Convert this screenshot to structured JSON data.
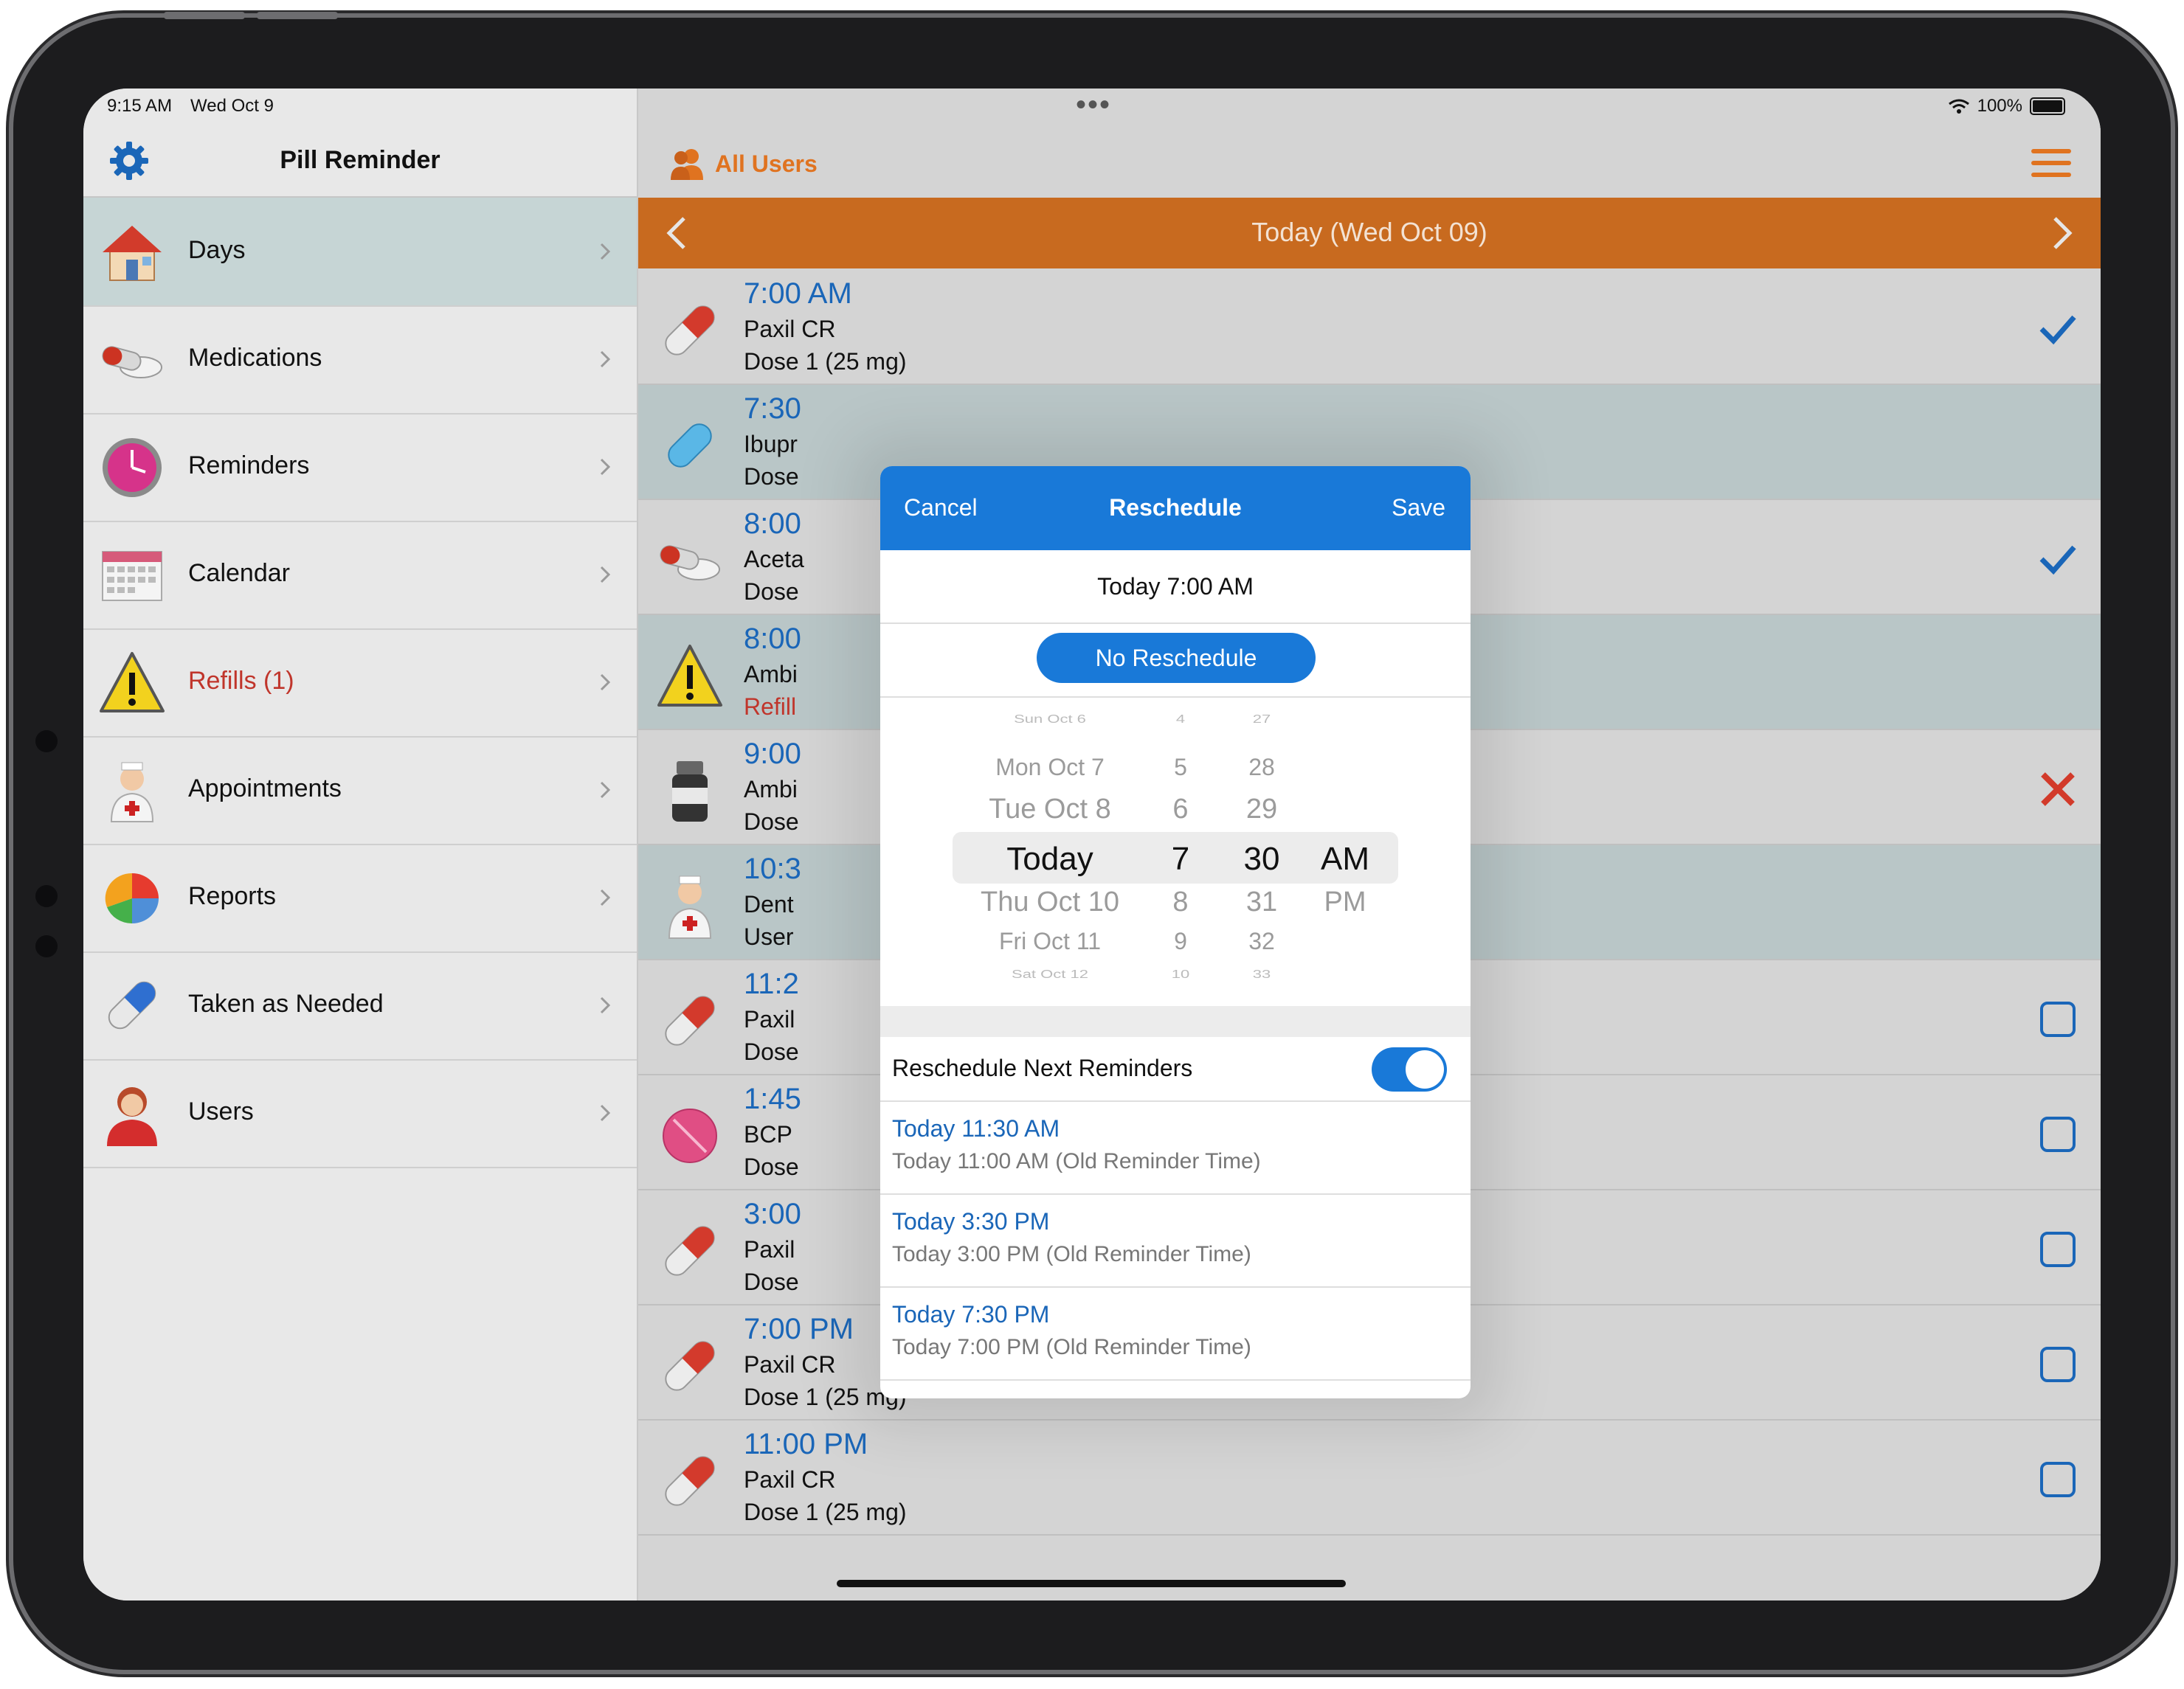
{
  "status": {
    "time": "9:15 AM",
    "date": "Wed Oct 9",
    "dots": "•••",
    "battery": "100%"
  },
  "sidebar": {
    "title": "Pill Reminder",
    "items": [
      {
        "label": "Days"
      },
      {
        "label": "Medications"
      },
      {
        "label": "Reminders"
      },
      {
        "label": "Calendar"
      },
      {
        "label": "Refills (1)"
      },
      {
        "label": "Appointments"
      },
      {
        "label": "Reports"
      },
      {
        "label": "Taken as Needed"
      },
      {
        "label": "Users"
      }
    ]
  },
  "header": {
    "users_label": "All Users",
    "date_title": "Today (Wed Oct 09)"
  },
  "reminders": [
    {
      "time": "7:00 AM",
      "name": "Paxil CR",
      "detail": "Dose 1 (25 mg)",
      "status": "taken"
    },
    {
      "time": "7:30",
      "name": "Ibupr",
      "detail": "Dose",
      "status": "none"
    },
    {
      "time": "8:00",
      "name": "Aceta",
      "detail": "Dose",
      "status": "taken"
    },
    {
      "time": "8:00",
      "name": "Ambi",
      "detail": "Refill",
      "status": "none"
    },
    {
      "time": "9:00",
      "name": "Ambi",
      "detail": "Dose",
      "status": "skipped"
    },
    {
      "time": "10:3",
      "name": "Dent",
      "detail": "User",
      "status": "none"
    },
    {
      "time": "11:2",
      "name": "Paxil",
      "detail": "Dose",
      "status": "pending"
    },
    {
      "time": "1:45",
      "name": "BCP",
      "detail": "Dose",
      "status": "pending"
    },
    {
      "time": "3:00",
      "name": "Paxil",
      "detail": "Dose",
      "status": "pending"
    },
    {
      "time": "7:00 PM",
      "name": "Paxil CR",
      "detail": "Dose 1 (25 mg)",
      "status": "pending"
    },
    {
      "time": "11:00 PM",
      "name": "Paxil CR",
      "detail": "Dose 1 (25 mg)",
      "status": "pending"
    }
  ],
  "modal": {
    "cancel": "Cancel",
    "title": "Reschedule",
    "save": "Save",
    "current": "Today 7:00 AM",
    "no_reschedule": "No Reschedule",
    "picker": {
      "days": [
        "Sun Oct 6",
        "Mon Oct 7",
        "Tue Oct 8",
        "Today",
        "Thu Oct 10",
        "Fri Oct 11",
        "Sat Oct 12"
      ],
      "hours": [
        "4",
        "5",
        "6",
        "7",
        "8",
        "9",
        "10"
      ],
      "minutes": [
        "27",
        "28",
        "29",
        "30",
        "31",
        "32",
        "33"
      ],
      "ampm": [
        "AM",
        "PM"
      ]
    },
    "toggle_label": "Reschedule Next Reminders",
    "toggle_on": true,
    "next": [
      {
        "new": "Today 11:30 AM",
        "old": "Today 11:00 AM (Old Reminder Time)"
      },
      {
        "new": "Today 3:30 PM",
        "old": "Today 3:00 PM (Old Reminder Time)"
      },
      {
        "new": "Today 7:30 PM",
        "old": "Today 7:00 PM (Old Reminder Time)"
      }
    ]
  },
  "colors": {
    "accent": "#1979d8",
    "orange": "#c86a1f",
    "red": "#c0352b"
  }
}
